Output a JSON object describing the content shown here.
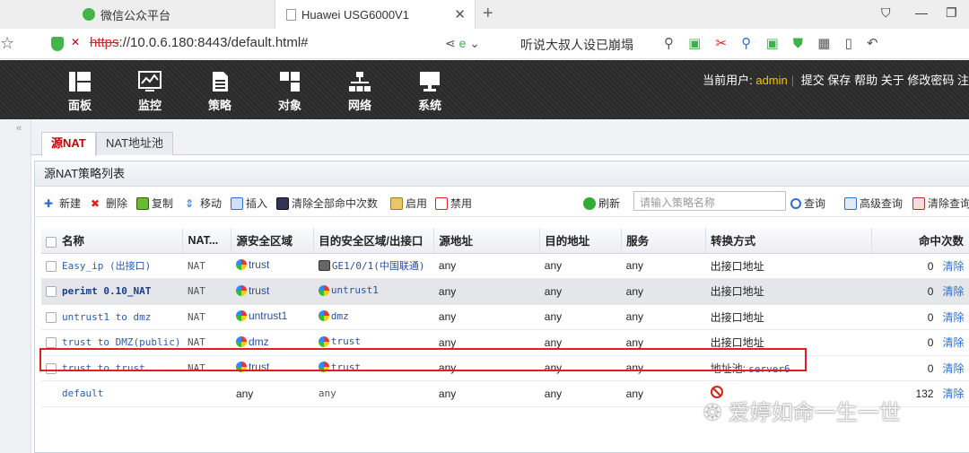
{
  "browser": {
    "tabs": [
      {
        "label": "微信公众平台"
      },
      {
        "label": "Huawei USG6000V1"
      }
    ],
    "url_scheme": "https",
    "url_rest": "://10.0.6.180:8443/default.html#",
    "search_text": "听说大叔人设已崩塌"
  },
  "header": {
    "nav": [
      {
        "label": "面板",
        "icon": "dashboard-icon"
      },
      {
        "label": "监控",
        "icon": "monitor-icon"
      },
      {
        "label": "策略",
        "icon": "policy-icon"
      },
      {
        "label": "对象",
        "icon": "object-icon"
      },
      {
        "label": "网络",
        "icon": "network-icon"
      },
      {
        "label": "系统",
        "icon": "system-icon"
      }
    ],
    "user_label": "当前用户:",
    "user_name": "admin",
    "links": [
      "提交",
      "保存",
      "帮助",
      "关于",
      "修改密码",
      "注"
    ]
  },
  "subtabs": [
    {
      "label": "源NAT"
    },
    {
      "label": "NAT地址池"
    }
  ],
  "panel_title": "源NAT策略列表",
  "toolbar": {
    "new": "新建",
    "delete": "删除",
    "copy": "复制",
    "move": "移动",
    "insert": "插入",
    "clear_all": "清除全部命中次数",
    "enable": "启用",
    "disable": "禁用",
    "refresh": "刷新",
    "search_placeholder": "请输入策略名称",
    "query": "查询",
    "advanced": "高级查询",
    "clear_query": "清除查询"
  },
  "table": {
    "headers": [
      "名称",
      "NAT...",
      "源安全区域",
      "目的安全区域/出接口",
      "源地址",
      "目的地址",
      "服务",
      "转换方式",
      "命中次数"
    ],
    "rows": [
      {
        "name": "Easy_ip (出接口)",
        "nat": "NAT",
        "src_zone": "trust",
        "dst": "GE1/0/1(中国联通)",
        "dst_type": "iface",
        "src_addr": "any",
        "dst_addr": "any",
        "service": "any",
        "mode": "出接口地址",
        "hits": "0",
        "clear": "清除"
      },
      {
        "name": "perimt 0.10_NAT",
        "nat": "NAT",
        "src_zone": "trust",
        "dst": "untrust1",
        "dst_type": "zone",
        "src_addr": "any",
        "dst_addr": "any",
        "service": "any",
        "mode": "出接口地址",
        "hits": "0",
        "clear": "清除"
      },
      {
        "name": "untrust1 to dmz",
        "nat": "NAT",
        "src_zone": "untrust1",
        "dst": "dmz",
        "dst_type": "zone",
        "src_addr": "any",
        "dst_addr": "any",
        "service": "any",
        "mode": "出接口地址",
        "hits": "0",
        "clear": "清除"
      },
      {
        "name": "trust to DMZ(public)",
        "nat": "NAT",
        "src_zone": "dmz",
        "dst": "trust",
        "dst_type": "zone",
        "src_addr": "any",
        "dst_addr": "any",
        "service": "any",
        "mode": "出接口地址",
        "hits": "0",
        "clear": "清除"
      },
      {
        "name": "trust to trust",
        "nat": "NAT",
        "src_zone": "trust",
        "dst": "trust",
        "dst_type": "zone",
        "src_addr": "any",
        "dst_addr": "any",
        "service": "any",
        "mode_label": "地址池:",
        "mode_value": "server6",
        "hits": "0",
        "clear": "清除"
      },
      {
        "name": "default",
        "nat": "",
        "src_zone": "any",
        "dst": "any",
        "dst_type": "text",
        "src_addr": "any",
        "dst_addr": "any",
        "service": "any",
        "mode": "forbid",
        "hits": "132",
        "clear": "清除"
      }
    ]
  },
  "watermark": "爱婷如命一生一世",
  "colors": {
    "accent": "#c00000",
    "link": "#2a6fd6",
    "highlight": "#e02020",
    "user": "#f5c400"
  }
}
